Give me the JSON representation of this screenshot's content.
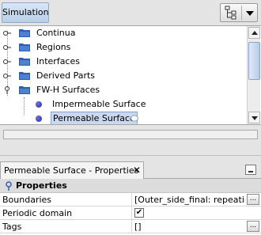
{
  "toolbar": {
    "simulation_button": "Simulation",
    "tree_view_icon": "tree-view-icon",
    "dropdown_icon": "chevron-down-icon"
  },
  "tree": {
    "items": [
      {
        "label": "Continua",
        "icon": "folder-icon",
        "expander": "collapsed"
      },
      {
        "label": "Regions",
        "icon": "folder-icon",
        "expander": "collapsed"
      },
      {
        "label": "Interfaces",
        "icon": "folder-icon",
        "expander": "collapsed"
      },
      {
        "label": "Derived Parts",
        "icon": "folder-icon",
        "expander": "collapsed"
      },
      {
        "label": "FW-H Surfaces",
        "icon": "folder-icon",
        "expander": "expanded"
      },
      {
        "label": "Impermeable Surface",
        "icon": "dot-icon"
      },
      {
        "label": "Permeable Surface",
        "icon": "dot-icon",
        "selected": true
      }
    ]
  },
  "properties": {
    "tab_label": "Permeable Surface - Properties",
    "close_glyph": "✕",
    "section_label": "Properties",
    "rows": [
      {
        "name": "Boundaries",
        "value": "[Outer_side_final: repeating ...",
        "button": "..."
      },
      {
        "name": "Periodic domain",
        "checked_glyph": "✔"
      },
      {
        "name": "Tags",
        "value": "[]",
        "button": "..."
      }
    ]
  },
  "colors": {
    "selection": "#c9d8ee",
    "folder": "#2f5fae",
    "dot": "#3a3ab8"
  }
}
